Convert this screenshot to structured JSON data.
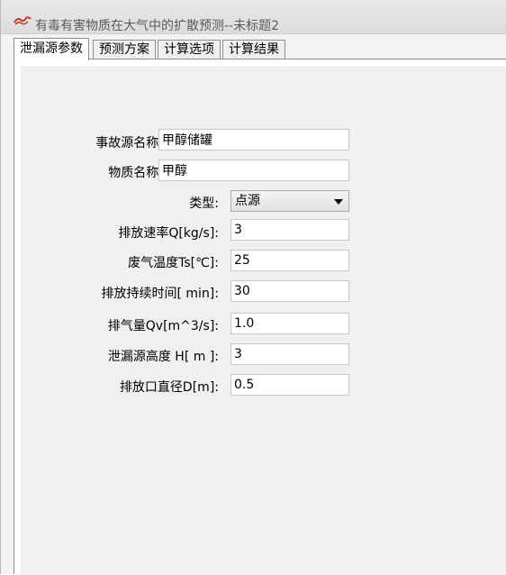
{
  "window": {
    "title": "有毒有害物质在大气中的扩散预测--未标题2",
    "icon": "app-logo-icon"
  },
  "tabs": [
    {
      "label": "泄漏源参数",
      "active": true
    },
    {
      "label": "预测方案",
      "active": false
    },
    {
      "label": "计算选项",
      "active": false
    },
    {
      "label": "计算结果",
      "active": false
    }
  ],
  "form": {
    "source_name": {
      "label": "事故源名称:",
      "value": "甲醇储罐"
    },
    "substance_name": {
      "label": "物质名称:",
      "value": "甲醇"
    },
    "type": {
      "label": "类型:",
      "value": "点源"
    },
    "emission_rate": {
      "label": "排放速率Q[kg/s]:",
      "value": "3"
    },
    "exhaust_temp": {
      "label": "废气温度Ts[℃]:",
      "value": "25"
    },
    "duration": {
      "label": "排放持续时间[ min]:",
      "value": "30"
    },
    "exhaust_volume": {
      "label": "排气量Qv[m^3/s]:",
      "value": "1.0"
    },
    "leak_height": {
      "label": "泄漏源高度 H[  m ]:",
      "value": "3"
    },
    "outlet_diameter": {
      "label": "排放口直径D[m]:",
      "value": "0.5"
    }
  }
}
